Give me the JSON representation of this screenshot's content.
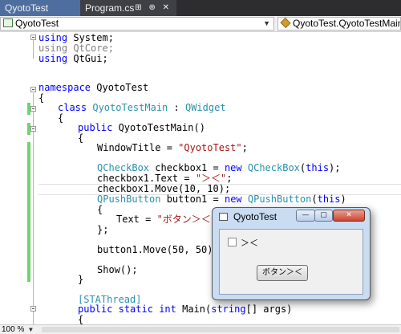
{
  "tabs": [
    {
      "label": "QyotoTest",
      "active": false
    },
    {
      "label": "Program.cs",
      "active": true,
      "icons": "⊞ ⊕ ✕"
    }
  ],
  "nav": {
    "left": "QyotoTest",
    "right": "QyotoTest.QyotoTestMain"
  },
  "code": {
    "l1": [
      "using",
      " System;"
    ],
    "l2": [
      "using",
      " QtCore;"
    ],
    "l3": [
      "using",
      " QtGui;"
    ],
    "l5": [
      "namespace",
      " QyotoTest"
    ],
    "l6": "{",
    "l7": [
      "class ",
      "QyotoTestMain",
      " : ",
      "QWidget"
    ],
    "l8": "{",
    "l9": [
      "public",
      " QyotoTestMain()"
    ],
    "l10": "{",
    "l11": [
      "WindowTitle = ",
      "\"QyotoTest\"",
      ";"
    ],
    "l13": [
      "QCheckBox",
      " checkbox1 = ",
      "new",
      " ",
      "QCheckBox",
      "(",
      "this",
      ");"
    ],
    "l14": [
      "checkbox1.Text = ",
      "\"＞＜\"",
      ";"
    ],
    "l15": "checkbox1.Move(10, 10);",
    "l16": [
      "QPushButton",
      " button1 = ",
      "new",
      " ",
      "QPushButton",
      "(",
      "this",
      ")"
    ],
    "l17": "{",
    "l18": [
      "Text = ",
      "\"ボタン＞＜\""
    ],
    "l19": "};",
    "l21": "button1.Move(50, 50);",
    "l23": "Show();",
    "l24": "}",
    "l26": "[STAThread]",
    "l27": [
      "public",
      " ",
      "static",
      " ",
      "int",
      " Main(",
      "string",
      "[] args)"
    ],
    "l28": "{"
  },
  "status": {
    "zoom": "100 %"
  },
  "window": {
    "title": "QyotoTest",
    "min_label": "—",
    "max_label": "▢",
    "close_label": "✕",
    "checkbox_label": "＞＜",
    "button_label": "ボタン＞＜"
  },
  "colors": {
    "keyword": "#0000ff",
    "type": "#2b91af",
    "string": "#a31515",
    "change_marker": "#6ed36e"
  }
}
